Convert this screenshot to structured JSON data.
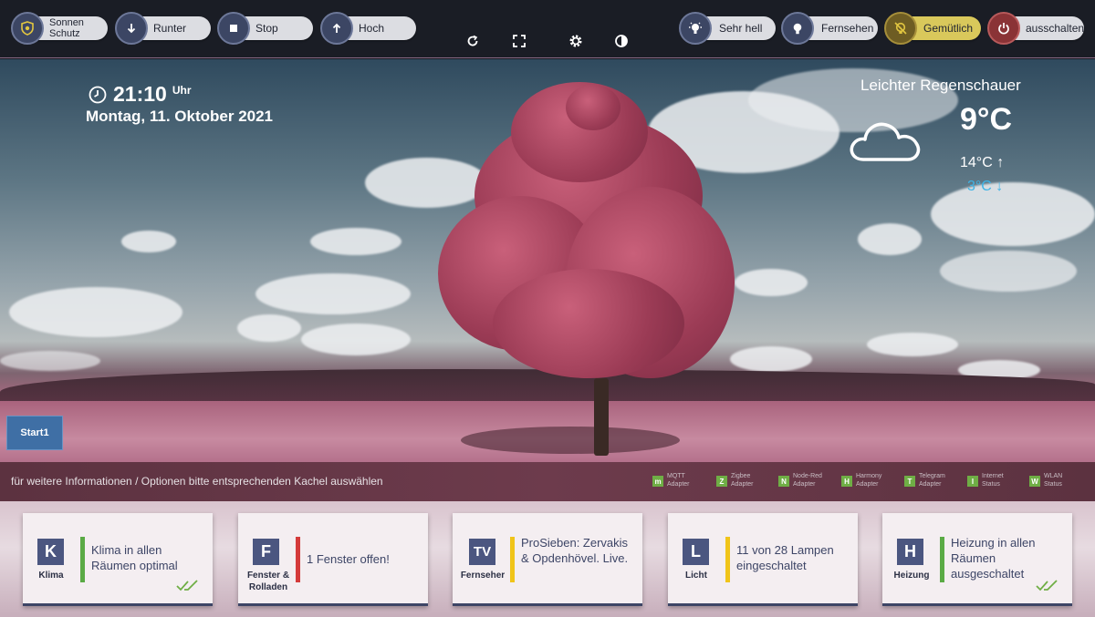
{
  "topbar": {
    "left_buttons": [
      {
        "label_line1": "Sonnen",
        "label_line2": "Schutz",
        "icon": "shield-icon"
      },
      {
        "label": "Runter",
        "icon": "arrow-down-icon"
      },
      {
        "label": "Stop",
        "icon": "stop-icon"
      },
      {
        "label": "Hoch",
        "icon": "arrow-up-icon"
      }
    ],
    "center_icons": [
      "refresh-icon",
      "fullscreen-icon",
      "gear-icon",
      "contrast-icon"
    ],
    "right_buttons": [
      {
        "label": "Sehr hell",
        "icon": "bright-bulb-icon"
      },
      {
        "label": "Fernsehen",
        "icon": "bulb-icon"
      },
      {
        "label": "Gemütlich",
        "icon": "cozy-bulb-icon",
        "active_color": "#d9c85b"
      },
      {
        "label": "ausschalten",
        "icon": "power-icon"
      }
    ]
  },
  "clock": {
    "time": "21:10",
    "unit": "Uhr",
    "date": "Montag, 11. Oktober 2021"
  },
  "weather": {
    "description": "Leichter Regenschauer",
    "temp": "9°C",
    "high": "14°C ↑",
    "low": "3°C ↓",
    "icon": "cloud-icon",
    "low_color": "#3fb4e6"
  },
  "start_button": {
    "label": "Start1"
  },
  "info": {
    "message": "für weitere Informationen / Optionen bitte entsprechenden Kachel auswählen",
    "adapters": [
      {
        "letter": "m",
        "line1": "MQTT",
        "line2": "Adapter"
      },
      {
        "letter": "Z",
        "line1": "Zigbee",
        "line2": "Adapter"
      },
      {
        "letter": "N",
        "line1": "Node-Red",
        "line2": "Adapter"
      },
      {
        "letter": "H",
        "line1": "Harmony",
        "line2": "Adapter"
      },
      {
        "letter": "T",
        "line1": "Telegram",
        "line2": "Adapter"
      },
      {
        "letter": "I",
        "line1": "Internet",
        "line2": "Status"
      },
      {
        "letter": "W",
        "line1": "WLAN",
        "line2": "Status"
      }
    ]
  },
  "cards": [
    {
      "badge": "K",
      "name": "Klima",
      "text": "Klima in allen Räumen optimal",
      "bar_color": "#5aaa45",
      "check": true
    },
    {
      "badge": "F",
      "name": "Fenster & Rolladen",
      "text": "1 Fenster offen!",
      "bar_color": "#d43a3a",
      "check": false
    },
    {
      "badge": "TV",
      "name": "Fernseher",
      "text": "ProSieben: Zervakis & Opdenhövel. Live.",
      "bar_color": "#f0c419",
      "check": false
    },
    {
      "badge": "L",
      "name": "Licht",
      "text": "11 von 28 Lampen eingeschaltet",
      "bar_color": "#f0c419",
      "check": false
    },
    {
      "badge": "H",
      "name": "Heizung",
      "text": "Heizung in allen Räumen ausgeschaltet",
      "bar_color": "#5aaa45",
      "check": true
    }
  ]
}
